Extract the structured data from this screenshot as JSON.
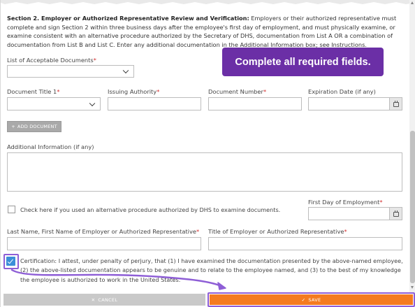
{
  "section2": {
    "heading": "Section 2. Employer or Authorized Representative Review and Verification:",
    "text": " Employers or their authorized representative must complete and sign Section 2 within three business days after the employee's first day of employment, and must physically examine, or examine consistent with an alternative procedure authorized by the Secretary of DHS, documentation from List A OR a combination of documentation from List B and List C. Enter any additional documentation in the Additional Information box; see Instructions."
  },
  "tooltip": {
    "text": "Complete all required fields."
  },
  "acceptable_docs": {
    "label": "List of Acceptable Documents",
    "required_mark": "*",
    "value": ""
  },
  "doc_row": {
    "document_title": {
      "label": "Document Title 1",
      "required_mark": "*",
      "value": ""
    },
    "issuing_authority": {
      "label": "Issuing Authority",
      "required_mark": "*",
      "value": ""
    },
    "document_number": {
      "label": "Document Number",
      "required_mark": "*",
      "value": ""
    },
    "expiration_date": {
      "label": "Expiration Date (if any)",
      "value": ""
    }
  },
  "add_document": {
    "icon": "+",
    "label": "ADD DOCUMENT"
  },
  "additional_info": {
    "label": "Additional Information (if any)",
    "value": ""
  },
  "alt_procedure": {
    "label": "Check here if you used an alternative procedure authorized by DHS to examine documents.",
    "checked": false
  },
  "first_day": {
    "label": "First Day of Employment",
    "required_mark": "*",
    "value": ""
  },
  "employer_name": {
    "label": "Last Name, First Name of Employer or Authorized Representative",
    "required_mark": "*",
    "value": ""
  },
  "employer_title": {
    "label": "Title of Employer or Authorized Representative",
    "required_mark": "*",
    "value": ""
  },
  "certification": {
    "checked": true,
    "text": "Certification: I attest, under penalty of perjury, that (1) I have examined the documentation presented by the above-named employee, (2) the above-listed documentation appears to be genuine and to relate to the employee named, and (3) to the best of my knowledge the employee is authorized to work in the United States."
  },
  "footer": {
    "cancel": {
      "icon": "✕",
      "label": "CANCEL"
    },
    "save": {
      "icon": "✓",
      "label": "SAVE"
    }
  },
  "colors": {
    "tooltip_bg": "#6b2fa6",
    "highlight": "#8e5ed6",
    "save_bg": "#f47b20",
    "cancel_bg": "#c9c9c9",
    "required": "#d32f2f",
    "checkbox_checked": "#3b8fd8"
  },
  "icons": {
    "select_chevron": "chevron-down-icon",
    "calendar": "calendar-icon",
    "checkmark": "checkmark-icon",
    "annotation_arrow": "arrow-icon"
  }
}
